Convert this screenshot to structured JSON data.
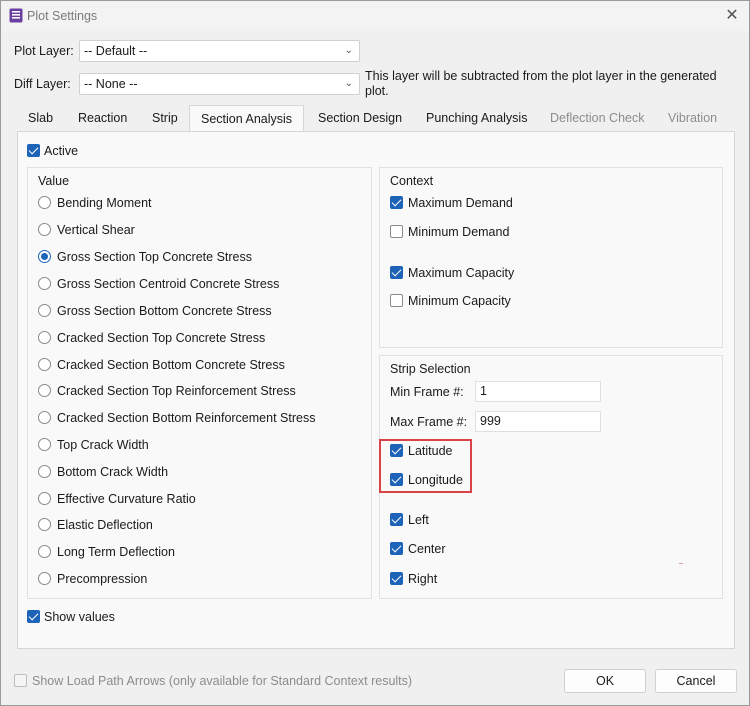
{
  "window": {
    "title": "Plot Settings",
    "close_glyph": "✕",
    "icon": "app-icon"
  },
  "plot_layer": {
    "label": "Plot Layer:",
    "value": "-- Default --"
  },
  "diff_layer": {
    "label": "Diff Layer:",
    "value": "-- None --",
    "note": "This layer will be subtracted from the plot layer in the generated plot."
  },
  "tabs": [
    {
      "label": "Slab",
      "state": "normal"
    },
    {
      "label": "Reaction",
      "state": "normal"
    },
    {
      "label": "Strip",
      "state": "normal"
    },
    {
      "label": "Section Analysis",
      "state": "active"
    },
    {
      "label": "Section Design",
      "state": "normal"
    },
    {
      "label": "Punching Analysis",
      "state": "normal"
    },
    {
      "label": "Deflection Check",
      "state": "disabled"
    },
    {
      "label": "Vibration",
      "state": "disabled"
    }
  ],
  "active": {
    "label": "Active",
    "checked": true
  },
  "value_group": {
    "title": "Value",
    "selected": "Gross Section Top Concrete Stress",
    "options": [
      "Bending Moment",
      "Vertical Shear",
      "Gross Section Top Concrete Stress",
      "Gross Section Centroid Concrete Stress",
      "Gross Section Bottom Concrete Stress",
      "Cracked Section Top Concrete Stress",
      "Cracked Section Bottom Concrete Stress",
      "Cracked Section Top Reinforcement Stress",
      "Cracked Section Bottom Reinforcement Stress",
      "Top Crack Width",
      "Bottom Crack Width",
      "Effective Curvature Ratio",
      "Elastic Deflection",
      "Long Term Deflection",
      "Precompression"
    ]
  },
  "context_group": {
    "title": "Context",
    "items": [
      {
        "label": "Maximum Demand",
        "checked": true
      },
      {
        "label": "Minimum Demand",
        "checked": false
      },
      {
        "label": "Maximum Capacity",
        "checked": true
      },
      {
        "label": "Minimum Capacity",
        "checked": false
      }
    ]
  },
  "strip_selection": {
    "title": "Strip Selection",
    "min_frame": {
      "label": "Min Frame #:",
      "value": "1"
    },
    "max_frame": {
      "label": "Max Frame #:",
      "value": "999"
    },
    "directions": [
      {
        "label": "Latitude",
        "checked": true
      },
      {
        "label": "Longitude",
        "checked": true
      }
    ],
    "positions": [
      {
        "label": "Left",
        "checked": true
      },
      {
        "label": "Center",
        "checked": true
      },
      {
        "label": "Right",
        "checked": true
      }
    ]
  },
  "show_values": {
    "label": "Show values",
    "checked": true
  },
  "load_path": {
    "label": "Show Load Path Arrows (only available for Standard Context results)",
    "checked": false,
    "enabled": false
  },
  "buttons": {
    "ok": "OK",
    "cancel": "Cancel"
  },
  "colors": {
    "accent": "#1d63b8",
    "highlight": "#d9434a"
  }
}
